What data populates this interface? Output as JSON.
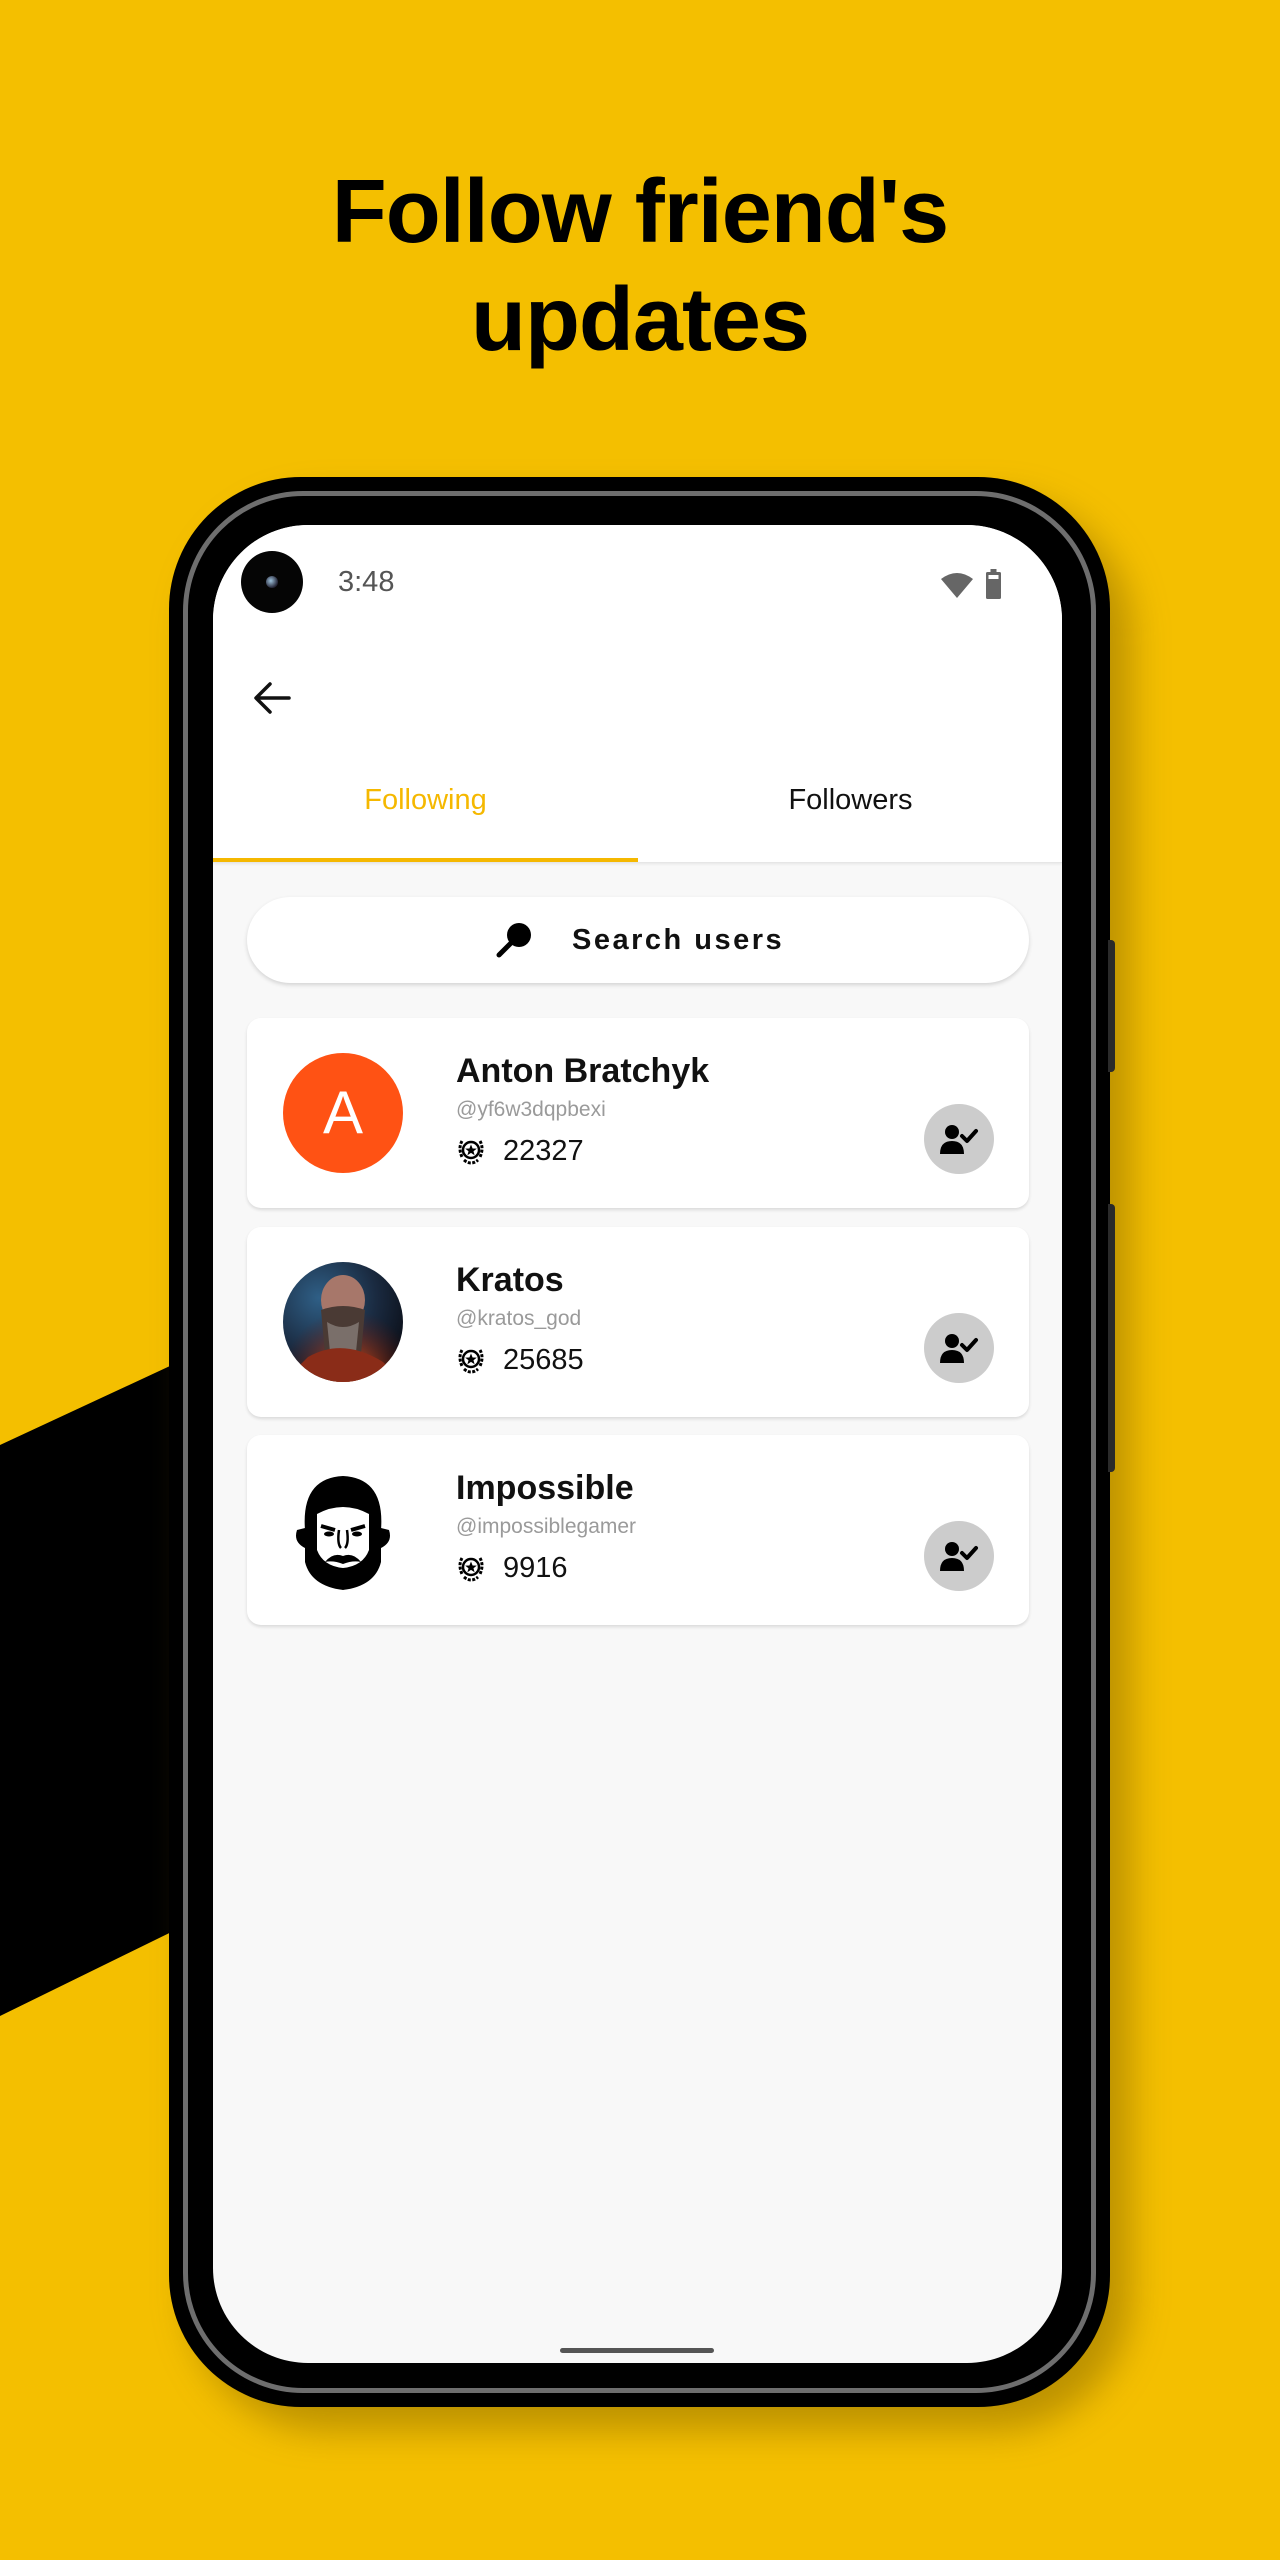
{
  "headline": {
    "line1": "Follow friend's",
    "line2": "updates"
  },
  "colors": {
    "background": "#F4BF00",
    "accent": "#F5B800",
    "avatar_orange": "#FF5214",
    "follow_button": "#CCCCCC"
  },
  "status_bar": {
    "time": "3:48",
    "icons": [
      "wifi-icon",
      "battery-icon"
    ]
  },
  "app_bar": {
    "back_icon": "arrow-left-icon"
  },
  "tabs": [
    {
      "label": "Following",
      "active": true
    },
    {
      "label": "Followers",
      "active": false
    }
  ],
  "search": {
    "label": "Search users",
    "icon": "search-icon"
  },
  "users": [
    {
      "name": "Anton Bratchyk",
      "handle": "@yf6w3dqpbexi",
      "score": "22327",
      "avatar": {
        "type": "letter",
        "letter": "A"
      },
      "following": true
    },
    {
      "name": "Kratos",
      "handle": "@kratos_god",
      "score": "25685",
      "avatar": {
        "type": "image",
        "description": "bearded warrior portrait"
      },
      "following": true
    },
    {
      "name": "Impossible",
      "handle": "@impossiblegamer",
      "score": "9916",
      "avatar": {
        "type": "image",
        "description": "black-and-white cartoon bearded face"
      },
      "following": true
    }
  ]
}
